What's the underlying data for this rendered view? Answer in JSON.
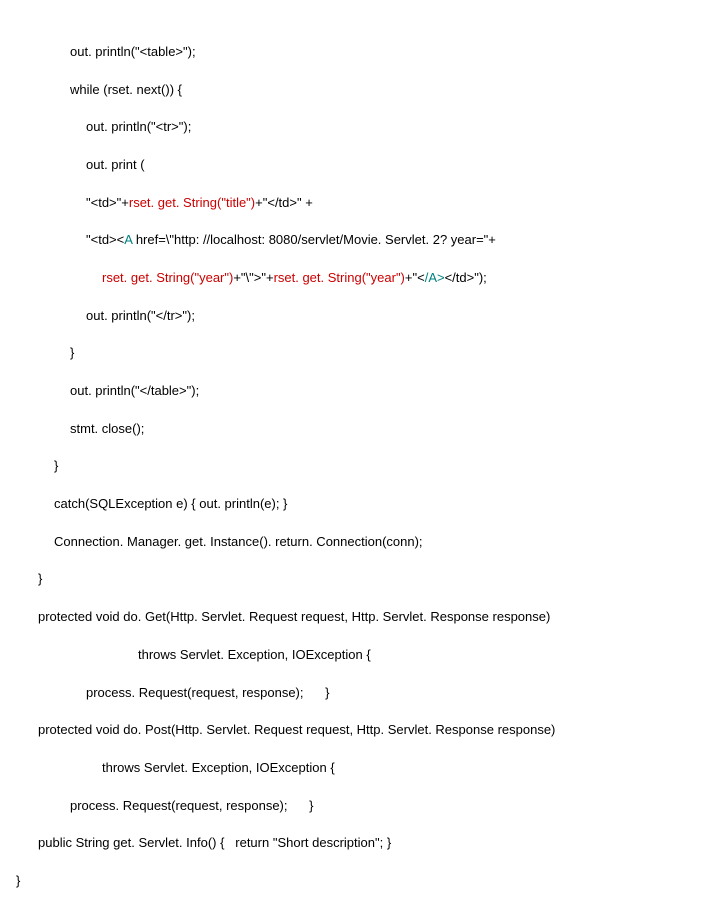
{
  "lines": {
    "l01a": "out. println(\"<table>\");",
    "l02a": "while (rset. next()) {",
    "l03a": "out. println(\"<tr>\");",
    "l04a": "out. print (",
    "l05a": "\"<td>\"+",
    "l05b": "rset. get. String(\"title\")",
    "l05c": "+\"</td>\" +",
    "l06a": "\"<td><",
    "l06b": "A",
    "l06c": " href=\\\"http: //localhost: 8080/servlet/Movie. Servlet. 2? year=\"+",
    "l07a": "rset. get. String(\"year\")",
    "l07b": "+\"\\\">\"+",
    "l07c": "rset. get. String(\"year\")",
    "l07d": "+\"<",
    "l07e": "/A>",
    "l07f": "</td>\");",
    "l08a": "out. println(\"</tr>\");",
    "l09a": "}",
    "l10a": "out. println(\"</table>\");",
    "l11a": "stmt. close();",
    "l12a": "}",
    "l13a": "catch(SQLException e) { out. println(e); }",
    "l14a": "Connection. Manager. get. Instance(). return. Connection(conn);",
    "l15a": "}",
    "l16a": "protected void do. Get(Http. Servlet. Request request, Http. Servlet. Response response)",
    "l17a": "throws Servlet. Exception, IOException {",
    "l18a": "process. Request(request, response);      }",
    "l19a": "protected void do. Post(Http. Servlet. Request request, Http. Servlet. Response response)",
    "l20a": "throws Servlet. Exception, IOException {",
    "l21a": "process. Request(request, response);      }",
    "l22a": "public String get. Servlet. Info() {   return \"Short description\"; }",
    "l23a": "}"
  }
}
